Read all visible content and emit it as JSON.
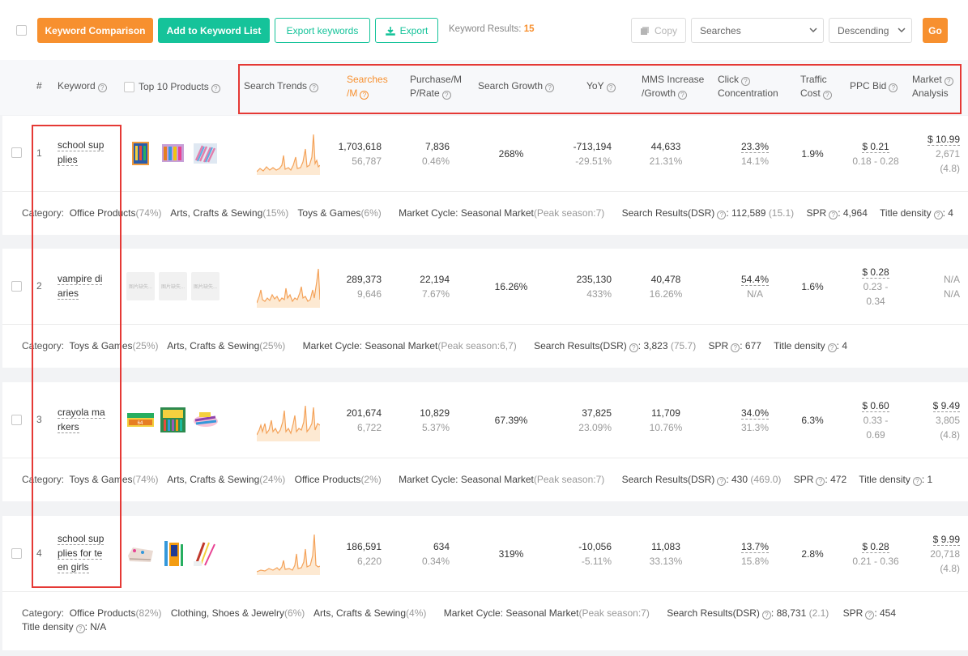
{
  "toolbar": {
    "keyword_comparison": "Keyword Comparison",
    "add_to_list": "Add to Keyword List",
    "export_keywords": "Export keywords",
    "export": "Export",
    "results_label": "Keyword Results:",
    "results_count": "15",
    "copy": "Copy",
    "sort_field": "Searches",
    "sort_order": "Descending",
    "go": "Go"
  },
  "header": {
    "num": "#",
    "keyword": "Keyword",
    "top10": "Top 10 Products",
    "search_trends": "Search Trends",
    "searches_l1": "Searches",
    "searches_l2": "/M",
    "purchase_l1": "Purchase/M",
    "purchase_l2": "P/Rate",
    "search_growth": "Search Growth",
    "yoy": "YoY",
    "mms_l1": "MMS Increase",
    "mms_l2": "/Growth",
    "click_l1": "Click",
    "click_l2": "Concentration",
    "traffic_l1": "Traffic",
    "traffic_l2": "Cost",
    "ppc": "PPC Bid",
    "market_l1": "Market",
    "market_l2": "Analysis"
  },
  "rows": [
    {
      "num": "1",
      "kw_lines": [
        "school sup",
        "plies"
      ],
      "searches": "1,703,618",
      "searches_sub": "56,787",
      "purchase": "7,836",
      "purchase_rate": "0.46%",
      "growth": "268%",
      "yoy": "-713,194",
      "yoy_pct": "-29.51%",
      "mms": "44,633",
      "mms_growth": "21.31%",
      "click": "23.3%",
      "click_sub": "14.1%",
      "traffic": "1.9%",
      "ppc": "$ 0.21",
      "ppc_range": "0.18 - 0.28",
      "market_price": "$ 10.99",
      "market_reviews": "2,671",
      "market_rating": "(4.8)",
      "category_label": "Category:",
      "categories": [
        {
          "name": "Office Products",
          "pct": "(74%)"
        },
        {
          "name": "Arts, Crafts & Sewing",
          "pct": "(15%)"
        },
        {
          "name": "Toys & Games",
          "pct": "(6%)"
        }
      ],
      "cycle_label": "Market Cycle:",
      "cycle": "Seasonal Market",
      "cycle_peak": "(Peak season:7)",
      "sr_label": "Search Results(DSR)",
      "sr_value": ": 112,589",
      "sr_dsr": "(15.1)",
      "spr_label": "SPR",
      "spr_value": ": 4,964",
      "title_label": "Title density",
      "title_value": ": 4"
    },
    {
      "num": "2",
      "kw_lines": [
        "vampire di",
        "aries"
      ],
      "searches": "289,373",
      "searches_sub": "9,646",
      "purchase": "22,194",
      "purchase_rate": "7.67%",
      "growth": "16.26%",
      "yoy": "235,130",
      "yoy_pct": "433%",
      "mms": "40,478",
      "mms_growth": "16.26%",
      "click": "54.4%",
      "click_sub": "N/A",
      "traffic": "1.6%",
      "ppc": "$ 0.28",
      "ppc_range_1": "0.23 -",
      "ppc_range_2": "0.34",
      "market_na1": "N/A",
      "market_na2": "N/A",
      "thumb_text": "图片缺失...",
      "category_label": "Category:",
      "categories": [
        {
          "name": "Toys & Games",
          "pct": "(25%)"
        },
        {
          "name": "Arts, Crafts & Sewing",
          "pct": "(25%)"
        }
      ],
      "cycle_label": "Market Cycle:",
      "cycle": "Seasonal Market",
      "cycle_peak": "(Peak season:6,7)",
      "sr_label": "Search Results(DSR)",
      "sr_value": ": 3,823",
      "sr_dsr": "(75.7)",
      "spr_label": "SPR",
      "spr_value": ": 677",
      "title_label": "Title density",
      "title_value": ": 4"
    },
    {
      "num": "3",
      "kw_lines": [
        "crayola ma",
        "rkers"
      ],
      "searches": "201,674",
      "searches_sub": "6,722",
      "purchase": "10,829",
      "purchase_rate": "5.37%",
      "growth": "67.39%",
      "yoy": "37,825",
      "yoy_pct": "23.09%",
      "mms": "11,709",
      "mms_growth": "10.76%",
      "click": "34.0%",
      "click_sub": "31.3%",
      "traffic": "6.3%",
      "ppc": "$ 0.60",
      "ppc_range_1": "0.33 -",
      "ppc_range_2": "0.69",
      "market_price": "$ 9.49",
      "market_reviews": "3,805",
      "market_rating": "(4.8)",
      "category_label": "Category:",
      "categories": [
        {
          "name": "Toys & Games",
          "pct": "(74%)"
        },
        {
          "name": "Arts, Crafts & Sewing",
          "pct": "(24%)"
        },
        {
          "name": "Office Products",
          "pct": "(2%)"
        }
      ],
      "cycle_label": "Market Cycle:",
      "cycle": "Seasonal Market",
      "cycle_peak": "(Peak season:7)",
      "sr_label": "Search Results(DSR)",
      "sr_value": ": 430",
      "sr_dsr": "(469.0)",
      "spr_label": "SPR",
      "spr_value": ": 472",
      "title_label": "Title density",
      "title_value": ": 1"
    },
    {
      "num": "4",
      "kw_lines": [
        "school sup",
        "plies for te",
        "en girls"
      ],
      "searches": "186,591",
      "searches_sub": "6,220",
      "purchase": "634",
      "purchase_rate": "0.34%",
      "growth": "319%",
      "yoy": "-10,056",
      "yoy_pct": "-5.11%",
      "mms": "11,083",
      "mms_growth": "33.13%",
      "click": "13.7%",
      "click_sub": "15.8%",
      "traffic": "2.8%",
      "ppc": "$ 0.28",
      "ppc_range": "0.21 - 0.36",
      "market_price": "$ 9.99",
      "market_reviews": "20,718",
      "market_rating": "(4.8)",
      "category_label": "Category:",
      "categories": [
        {
          "name": "Office Products",
          "pct": "(82%)"
        },
        {
          "name": "Clothing, Shoes & Jewelry",
          "pct": "(6%)"
        },
        {
          "name": "Arts, Crafts & Sewing",
          "pct": "(4%)"
        }
      ],
      "cycle_label": "Market Cycle:",
      "cycle": "Seasonal Market",
      "cycle_peak": "(Peak season:7)",
      "sr_label": "Search Results(DSR)",
      "sr_value": ": 88,731",
      "sr_dsr": "(2.1)",
      "spr_label": "SPR",
      "spr_value": ": 454",
      "title_label": "Title density",
      "title_value": ": N/A"
    }
  ],
  "colors": {
    "orange": "#f7902f",
    "teal": "#15c39a",
    "highlight": "#e53935"
  }
}
